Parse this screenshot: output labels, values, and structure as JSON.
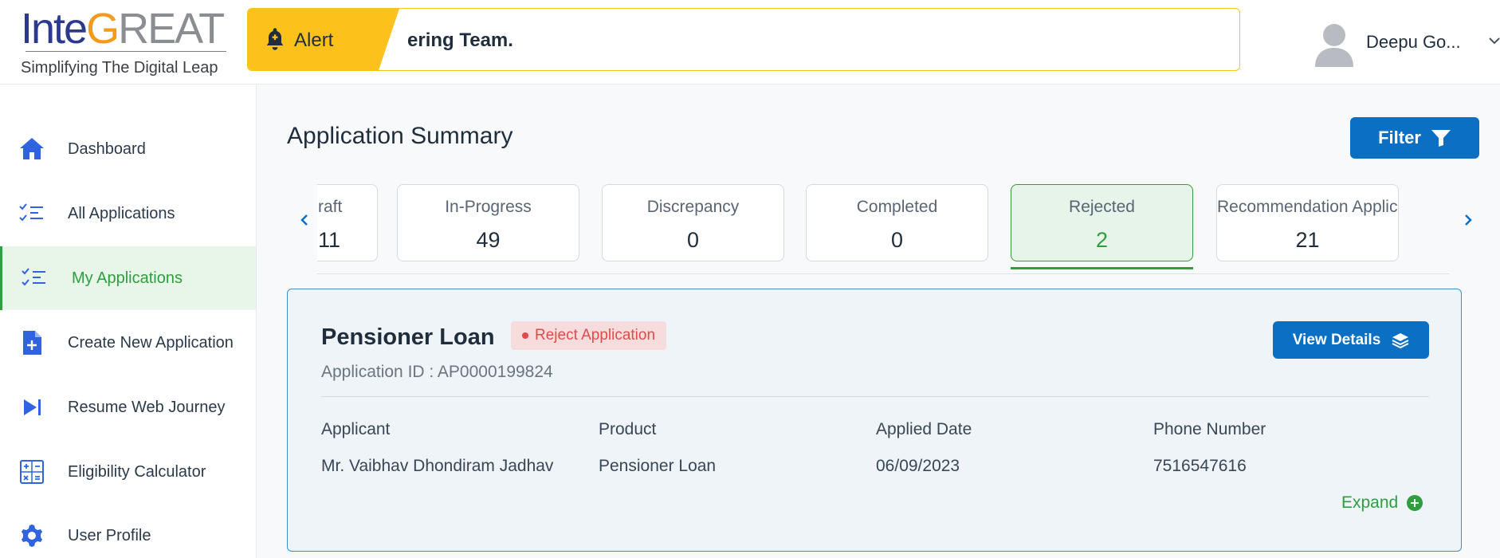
{
  "brand": {
    "logo_part1": "Inte",
    "logo_part2": "G",
    "logo_part3": "REAT",
    "tagline": "Simplifying The Digital Leap",
    "colors": {
      "primary": "#0b6fc4",
      "accent": "#2e9e3e",
      "alert": "#fcc21b",
      "danger": "#e04a4a"
    }
  },
  "alert": {
    "label": "Alert",
    "text": "ering Team.",
    "icon": "bell-icon"
  },
  "user": {
    "name": "Deepu Go...",
    "icon": "avatar-icon"
  },
  "sidebar": {
    "items": [
      {
        "label": "Dashboard",
        "icon": "home-icon"
      },
      {
        "label": "All Applications",
        "icon": "checklist-icon"
      },
      {
        "label": "My Applications",
        "icon": "checklist-icon",
        "active": true
      },
      {
        "label": "Create New Application",
        "icon": "file-plus-icon"
      },
      {
        "label": "Resume Web Journey",
        "icon": "skip-forward-icon"
      },
      {
        "label": "Eligibility Calculator",
        "icon": "calculator-icon"
      },
      {
        "label": "User Profile",
        "icon": "gear-icon"
      }
    ]
  },
  "main": {
    "title": "Application Summary",
    "filter_label": "Filter",
    "statuses": [
      {
        "label": "raft",
        "count": "11"
      },
      {
        "label": "In-Progress",
        "count": "49"
      },
      {
        "label": "Discrepancy",
        "count": "0"
      },
      {
        "label": "Completed",
        "count": "0"
      },
      {
        "label": "Rejected",
        "count": "2",
        "active": true
      },
      {
        "label": "Recommendation Applicatio",
        "count": "21"
      }
    ],
    "application": {
      "product_title": "Pensioner Loan",
      "status_badge": "Reject Application",
      "app_id": "Application ID : AP0000199824",
      "view_details": "View Details",
      "columns": [
        {
          "head": "Applicant",
          "value": "Mr. Vaibhav Dhondiram Jadhav"
        },
        {
          "head": "Product",
          "value": "Pensioner Loan"
        },
        {
          "head": "Applied Date",
          "value": "06/09/2023"
        },
        {
          "head": "Phone Number",
          "value": "7516547616"
        }
      ],
      "expand_label": "Expand"
    }
  }
}
